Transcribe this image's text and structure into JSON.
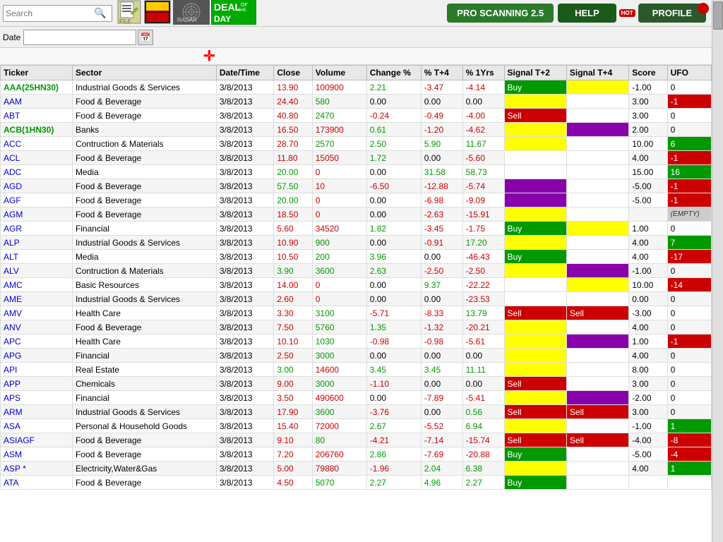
{
  "toolbar": {
    "search_placeholder": "Search",
    "date_label": "Date",
    "date_value": "",
    "pro_scan_label": "PRO SCANNING 2.5",
    "help_label": "HELP",
    "profile_label": "PROFILE",
    "file_icon": "📄",
    "bag_icon": "🛍",
    "radar_icon": "RADAR",
    "deal_line1": "DEAL",
    "deal_line2": "OF THE",
    "deal_line3": "DAY"
  },
  "table": {
    "headers": [
      "Ticker",
      "Sector",
      "Date/Time",
      "Close",
      "Volume",
      "Change %",
      "% T+4",
      "% 1Yrs",
      "Signal T+2",
      "Signal T+4",
      "Score",
      "UFO"
    ],
    "rows": [
      {
        "ticker": "AAA(25HN30)",
        "ticker_color": "green",
        "sector": "Industrial Goods & Services",
        "dt": "3/8/2013",
        "close": "13.90",
        "close_color": "red",
        "volume": "100900",
        "volume_color": "red",
        "change": 2.21,
        "pct_t4": -3.47,
        "pct_1yr": -4.14,
        "pct_1yr_color": "red",
        "sig_t2": "Buy",
        "sig_t2_bg": "green",
        "sig_t4": "",
        "sig_t4_bg": "yellow",
        "score": "-1.00",
        "ufo": "0",
        "ufo_bg": "white"
      },
      {
        "ticker": "AAM",
        "ticker_color": "black",
        "sector": "Food & Beverage",
        "dt": "3/8/2013",
        "close": "24.40",
        "close_color": "red",
        "volume": "580",
        "volume_color": "green",
        "change": 0.0,
        "pct_t4": 0.0,
        "pct_1yr": 0.0,
        "pct_1yr_color": "black",
        "sig_t2": "",
        "sig_t2_bg": "yellow",
        "sig_t4": "",
        "sig_t4_bg": "white",
        "score": "3.00",
        "ufo": "-1",
        "ufo_bg": "red"
      },
      {
        "ticker": "ABT",
        "ticker_color": "black",
        "sector": "Food & Beverage",
        "dt": "3/8/2013",
        "close": "40.80",
        "close_color": "red",
        "volume": "2470",
        "volume_color": "green",
        "change": -0.24,
        "pct_t4": -0.49,
        "pct_1yr": -4.0,
        "pct_1yr_color": "red",
        "sig_t2": "Sell",
        "sig_t2_bg": "red",
        "sig_t4": "",
        "sig_t4_bg": "white",
        "score": "3.00",
        "ufo": "0",
        "ufo_bg": "white"
      },
      {
        "ticker": "ACB(1HN30)",
        "ticker_color": "green",
        "sector": "Banks",
        "dt": "3/8/2013",
        "close": "16.50",
        "close_color": "red",
        "volume": "173900",
        "volume_color": "red",
        "change": 0.61,
        "pct_t4": -1.2,
        "pct_1yr": -4.62,
        "pct_1yr_color": "red",
        "sig_t2": "",
        "sig_t2_bg": "yellow",
        "sig_t4": "",
        "sig_t4_bg": "purple",
        "score": "2.00",
        "ufo": "0",
        "ufo_bg": "white"
      },
      {
        "ticker": "ACC",
        "ticker_color": "black",
        "sector": "Contruction & Materials",
        "dt": "3/8/2013",
        "close": "28.70",
        "close_color": "red",
        "volume": "2570",
        "volume_color": "green",
        "change": 2.5,
        "pct_t4": 5.9,
        "pct_1yr": 11.67,
        "pct_1yr_color": "green",
        "sig_t2": "",
        "sig_t2_bg": "yellow",
        "sig_t4": "",
        "sig_t4_bg": "white",
        "score": "10.00",
        "ufo": "6",
        "ufo_bg": "green"
      },
      {
        "ticker": "ACL",
        "ticker_color": "black",
        "sector": "Food & Beverage",
        "dt": "3/8/2013",
        "close": "11.80",
        "close_color": "red",
        "volume": "15050",
        "volume_color": "red",
        "change": 1.72,
        "pct_t4": 0.0,
        "pct_1yr": -5.6,
        "pct_1yr_color": "red",
        "sig_t2": "",
        "sig_t2_bg": "white",
        "sig_t4": "",
        "sig_t4_bg": "white",
        "score": "4.00",
        "ufo": "-1",
        "ufo_bg": "red"
      },
      {
        "ticker": "ADC",
        "ticker_color": "black",
        "sector": "Media",
        "dt": "3/8/2013",
        "close": "20.00",
        "close_color": "green",
        "volume": "0",
        "volume_color": "red",
        "change": 0.0,
        "pct_t4": 31.58,
        "pct_1yr": 58.73,
        "pct_1yr_color": "green",
        "sig_t2": "",
        "sig_t2_bg": "white",
        "sig_t4": "",
        "sig_t4_bg": "white",
        "score": "15.00",
        "ufo": "16",
        "ufo_bg": "green"
      },
      {
        "ticker": "AGD",
        "ticker_color": "black",
        "sector": "Food & Beverage",
        "dt": "3/8/2013",
        "close": "57.50",
        "close_color": "green",
        "volume": "10",
        "volume_color": "red",
        "change": -6.5,
        "pct_t4": -12.88,
        "pct_1yr": -5.74,
        "pct_1yr_color": "red",
        "sig_t2": "",
        "sig_t2_bg": "purple",
        "sig_t4": "",
        "sig_t4_bg": "white",
        "score": "-5.00",
        "ufo": "-1",
        "ufo_bg": "red"
      },
      {
        "ticker": "AGF",
        "ticker_color": "black",
        "sector": "Food & Beverage",
        "dt": "3/8/2013",
        "close": "20.00",
        "close_color": "green",
        "volume": "0",
        "volume_color": "red",
        "change": 0.0,
        "pct_t4": -6.98,
        "pct_1yr": -9.09,
        "pct_1yr_color": "red",
        "sig_t2": "",
        "sig_t2_bg": "purple",
        "sig_t4": "",
        "sig_t4_bg": "white",
        "score": "-5.00",
        "ufo": "-1",
        "ufo_bg": "red"
      },
      {
        "ticker": "AGM",
        "ticker_color": "black",
        "sector": "Food & Beverage",
        "dt": "3/8/2013",
        "close": "18.50",
        "close_color": "red",
        "volume": "0",
        "volume_color": "red",
        "change": 0.0,
        "pct_t4": -2.63,
        "pct_1yr": -15.91,
        "pct_1yr_color": "red",
        "sig_t2": "",
        "sig_t2_bg": "yellow",
        "sig_t4": "",
        "sig_t4_bg": "white",
        "score": "",
        "ufo": "(EMPTY)",
        "ufo_bg": "empty"
      },
      {
        "ticker": "AGR",
        "ticker_color": "black",
        "sector": "Financial",
        "dt": "3/8/2013",
        "close": "5.60",
        "close_color": "red",
        "volume": "34520",
        "volume_color": "red",
        "change": 1.82,
        "pct_t4": -3.45,
        "pct_1yr": -1.75,
        "pct_1yr_color": "red",
        "sig_t2": "Buy",
        "sig_t2_bg": "green",
        "sig_t4": "",
        "sig_t4_bg": "yellow",
        "score": "1.00",
        "ufo": "0",
        "ufo_bg": "white"
      },
      {
        "ticker": "ALP",
        "ticker_color": "black",
        "sector": "Industrial Goods & Services",
        "dt": "3/8/2013",
        "close": "10.90",
        "close_color": "red",
        "volume": "900",
        "volume_color": "green",
        "change": 0.0,
        "pct_t4": -0.91,
        "pct_1yr": 17.2,
        "pct_1yr_color": "green",
        "sig_t2": "",
        "sig_t2_bg": "yellow",
        "sig_t4": "",
        "sig_t4_bg": "white",
        "score": "4.00",
        "ufo": "7",
        "ufo_bg": "green"
      },
      {
        "ticker": "ALT",
        "ticker_color": "black",
        "sector": "Media",
        "dt": "3/8/2013",
        "close": "10.50",
        "close_color": "red",
        "volume": "200",
        "volume_color": "green",
        "change": 3.96,
        "pct_t4": 0.0,
        "pct_1yr": -46.43,
        "pct_1yr_color": "red",
        "sig_t2": "Buy",
        "sig_t2_bg": "green",
        "sig_t4": "",
        "sig_t4_bg": "white",
        "score": "4.00",
        "ufo": "-17",
        "ufo_bg": "red"
      },
      {
        "ticker": "ALV",
        "ticker_color": "black",
        "sector": "Contruction & Materials",
        "dt": "3/8/2013",
        "close": "3.90",
        "close_color": "green",
        "volume": "3600",
        "volume_color": "green",
        "change": 2.63,
        "pct_t4": -2.5,
        "pct_1yr": -2.5,
        "pct_1yr_color": "red",
        "sig_t2": "",
        "sig_t2_bg": "yellow",
        "sig_t4": "",
        "sig_t4_bg": "purple",
        "score": "-1.00",
        "ufo": "0",
        "ufo_bg": "white"
      },
      {
        "ticker": "AMC",
        "ticker_color": "black",
        "sector": "Basic Resources",
        "dt": "3/8/2013",
        "close": "14.00",
        "close_color": "red",
        "volume": "0",
        "volume_color": "red",
        "change": 0.0,
        "pct_t4": 9.37,
        "pct_1yr": -22.22,
        "pct_1yr_color": "red",
        "sig_t2": "",
        "sig_t2_bg": "white",
        "sig_t4": "",
        "sig_t4_bg": "yellow",
        "score": "10.00",
        "ufo": "-14",
        "ufo_bg": "red"
      },
      {
        "ticker": "AME",
        "ticker_color": "black",
        "sector": "Industrial Goods & Services",
        "dt": "3/8/2013",
        "close": "2.60",
        "close_color": "red",
        "volume": "0",
        "volume_color": "red",
        "change": 0.0,
        "pct_t4": 0.0,
        "pct_1yr": -23.53,
        "pct_1yr_color": "red",
        "sig_t2": "",
        "sig_t2_bg": "white",
        "sig_t4": "",
        "sig_t4_bg": "white",
        "score": "0.00",
        "ufo": "0",
        "ufo_bg": "white"
      },
      {
        "ticker": "AMV",
        "ticker_color": "black",
        "sector": "Health Care",
        "dt": "3/8/2013",
        "close": "3.30",
        "close_color": "red",
        "volume": "3100",
        "volume_color": "green",
        "change": -5.71,
        "pct_t4": -8.33,
        "pct_1yr": 13.79,
        "pct_1yr_color": "green",
        "sig_t2": "Sell",
        "sig_t2_bg": "red",
        "sig_t4": "Sell",
        "sig_t4_bg": "red",
        "score": "-3.00",
        "ufo": "0",
        "ufo_bg": "white"
      },
      {
        "ticker": "ANV",
        "ticker_color": "black",
        "sector": "Food & Beverage",
        "dt": "3/8/2013",
        "close": "7.50",
        "close_color": "red",
        "volume": "5760",
        "volume_color": "green",
        "change": 1.35,
        "pct_t4": -1.32,
        "pct_1yr": -20.21,
        "pct_1yr_color": "red",
        "sig_t2": "",
        "sig_t2_bg": "yellow",
        "sig_t4": "",
        "sig_t4_bg": "white",
        "score": "4.00",
        "ufo": "0",
        "ufo_bg": "white"
      },
      {
        "ticker": "APC",
        "ticker_color": "black",
        "sector": "Health Care",
        "dt": "3/8/2013",
        "close": "10.10",
        "close_color": "red",
        "volume": "1030",
        "volume_color": "green",
        "change": -0.98,
        "pct_t4": -0.98,
        "pct_1yr": -5.61,
        "pct_1yr_color": "red",
        "sig_t2": "",
        "sig_t2_bg": "yellow",
        "sig_t4": "",
        "sig_t4_bg": "purple",
        "score": "1.00",
        "ufo": "-1",
        "ufo_bg": "red"
      },
      {
        "ticker": "APG",
        "ticker_color": "black",
        "sector": "Financial",
        "dt": "3/8/2013",
        "close": "2.50",
        "close_color": "red",
        "volume": "3000",
        "volume_color": "green",
        "change": 0.0,
        "pct_t4": 0.0,
        "pct_1yr": 0.0,
        "pct_1yr_color": "black",
        "sig_t2": "",
        "sig_t2_bg": "yellow",
        "sig_t4": "",
        "sig_t4_bg": "white",
        "score": "4.00",
        "ufo": "0",
        "ufo_bg": "white"
      },
      {
        "ticker": "API",
        "ticker_color": "black",
        "sector": "Real Estate",
        "dt": "3/8/2013",
        "close": "3.00",
        "close_color": "green",
        "volume": "14600",
        "volume_color": "red",
        "change": 3.45,
        "pct_t4": 3.45,
        "pct_1yr": 11.11,
        "pct_1yr_color": "green",
        "sig_t2": "",
        "sig_t2_bg": "yellow",
        "sig_t4": "",
        "sig_t4_bg": "white",
        "score": "8.00",
        "ufo": "0",
        "ufo_bg": "white"
      },
      {
        "ticker": "APP",
        "ticker_color": "black",
        "sector": "Chemicals",
        "dt": "3/8/2013",
        "close": "9.00",
        "close_color": "red",
        "volume": "3000",
        "volume_color": "green",
        "change": -1.1,
        "pct_t4": 0.0,
        "pct_1yr": 0.0,
        "pct_1yr_color": "black",
        "sig_t2": "Sell",
        "sig_t2_bg": "red",
        "sig_t4": "",
        "sig_t4_bg": "white",
        "score": "3.00",
        "ufo": "0",
        "ufo_bg": "white"
      },
      {
        "ticker": "APS",
        "ticker_color": "black",
        "sector": "Financial",
        "dt": "3/8/2013",
        "close": "3.50",
        "close_color": "red",
        "volume": "490600",
        "volume_color": "red",
        "change": 0.0,
        "pct_t4": -7.89,
        "pct_1yr": -5.41,
        "pct_1yr_color": "red",
        "sig_t2": "",
        "sig_t2_bg": "yellow",
        "sig_t4": "",
        "sig_t4_bg": "purple",
        "score": "-2.00",
        "ufo": "0",
        "ufo_bg": "white"
      },
      {
        "ticker": "ARM",
        "ticker_color": "black",
        "sector": "Industrial Goods & Services",
        "dt": "3/8/2013",
        "close": "17.90",
        "close_color": "red",
        "volume": "3600",
        "volume_color": "green",
        "change": -3.76,
        "pct_t4": 0.0,
        "pct_1yr": 0.56,
        "pct_1yr_color": "green",
        "sig_t2": "Sell",
        "sig_t2_bg": "red",
        "sig_t4": "Sell",
        "sig_t4_bg": "red",
        "score": "3.00",
        "ufo": "0",
        "ufo_bg": "white"
      },
      {
        "ticker": "ASA",
        "ticker_color": "black",
        "sector": "Personal & Household Goods",
        "dt": "3/8/2013",
        "close": "15.40",
        "close_color": "red",
        "volume": "72000",
        "volume_color": "red",
        "change": 2.67,
        "pct_t4": -5.52,
        "pct_1yr": 6.94,
        "pct_1yr_color": "green",
        "sig_t2": "",
        "sig_t2_bg": "yellow",
        "sig_t4": "",
        "sig_t4_bg": "white",
        "score": "-1.00",
        "ufo": "1",
        "ufo_bg": "green"
      },
      {
        "ticker": "ASIAGF",
        "ticker_color": "black",
        "sector": "Food & Beverage",
        "dt": "3/8/2013",
        "close": "9.10",
        "close_color": "red",
        "volume": "80",
        "volume_color": "green",
        "change": -4.21,
        "pct_t4": -7.14,
        "pct_1yr": -15.74,
        "pct_1yr_color": "red",
        "sig_t2": "Sell",
        "sig_t2_bg": "red",
        "sig_t4": "Sell",
        "sig_t4_bg": "red",
        "score": "-4.00",
        "ufo": "-8",
        "ufo_bg": "red"
      },
      {
        "ticker": "ASM",
        "ticker_color": "black",
        "sector": "Food & Beverage",
        "dt": "3/8/2013",
        "close": "7.20",
        "close_color": "red",
        "volume": "206760",
        "volume_color": "red",
        "change": 2.86,
        "pct_t4": -7.69,
        "pct_1yr": -20.88,
        "pct_1yr_color": "red",
        "sig_t2": "Buy",
        "sig_t2_bg": "green",
        "sig_t4": "",
        "sig_t4_bg": "white",
        "score": "-5.00",
        "ufo": "-4",
        "ufo_bg": "red"
      },
      {
        "ticker": "ASP *",
        "ticker_color": "black",
        "sector": "Electricity,Water&Gas",
        "dt": "3/8/2013",
        "close": "5.00",
        "close_color": "red",
        "volume": "79880",
        "volume_color": "red",
        "change": -1.96,
        "pct_t4": 2.04,
        "pct_1yr": 6.38,
        "pct_1yr_color": "green",
        "sig_t2": "",
        "sig_t2_bg": "yellow",
        "sig_t4": "",
        "sig_t4_bg": "white",
        "score": "4.00",
        "ufo": "1",
        "ufo_bg": "green"
      },
      {
        "ticker": "ATA",
        "ticker_color": "black",
        "sector": "Food & Beverage",
        "dt": "3/8/2013",
        "close": "4.50",
        "close_color": "red",
        "volume": "5070",
        "volume_color": "green",
        "change": 2.27,
        "pct_t4": 4.96,
        "pct_1yr": 2.27,
        "pct_1yr_color": "green",
        "sig_t2": "Buy",
        "sig_t2_bg": "green",
        "sig_t4": "",
        "sig_t4_bg": "white",
        "score": "",
        "ufo": "",
        "ufo_bg": "white"
      }
    ]
  }
}
